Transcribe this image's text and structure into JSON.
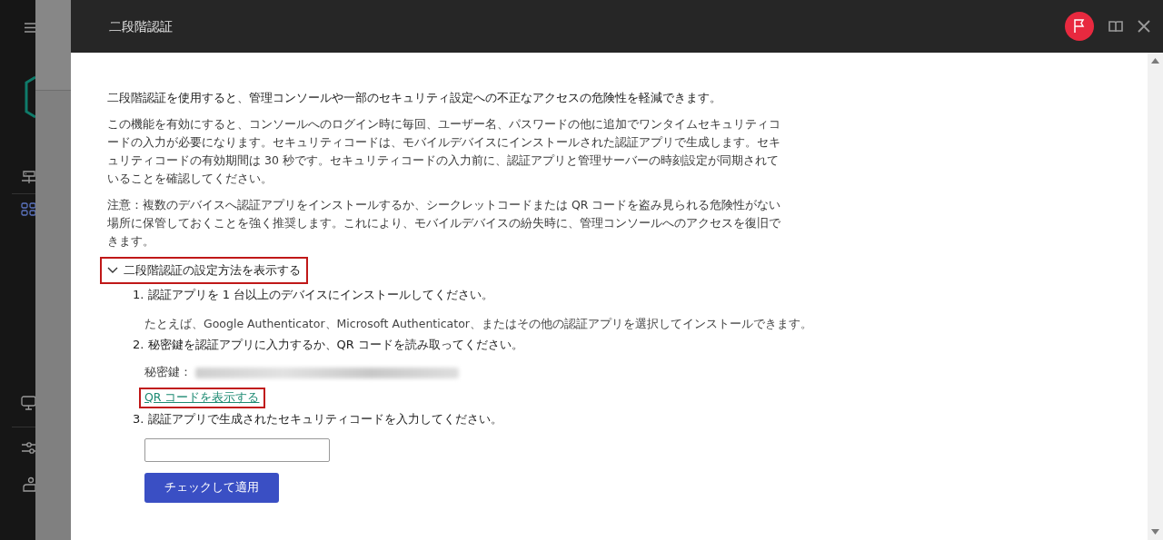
{
  "sidebar": {
    "items": [
      {
        "kind": "network",
        "selected": false
      },
      {
        "kind": "apps",
        "selected": true
      },
      {
        "kind": "monitor",
        "selected": false
      },
      {
        "kind": "sliders",
        "selected": false
      },
      {
        "kind": "user",
        "selected": false
      }
    ]
  },
  "dialog": {
    "title": "二段階認証",
    "intro": "二段階認証を使用すると、管理コンソールや一部のセキュリティ設定への不正なアクセスの危険性を軽減できます。",
    "paragraphs": [
      "この機能を有効にすると、コンソールへのログイン時に毎回、ユーザー名、パスワードの他に追加でワンタイムセキュリティコードの入力が必要になります。セキュリティコードは、モバイルデバイスにインストールされた認証アプリで生成します。セキュリティコードの有効期間は 30 秒です。セキュリティコードの入力前に、認証アプリと管理サーバーの時刻設定が同期されていることを確認してください。",
      "注意：複数のデバイスへ認証アプリをインストールするか、シークレットコードまたは QR コードを盗み見られる危険性がない場所に保管しておくことを強く推奨します。これにより、モバイルデバイスの紛失時に、管理コンソールへのアクセスを復旧できます。"
    ],
    "expander": {
      "label": "二段階認証の設定方法を表示する",
      "expanded": true,
      "highlighted": true
    },
    "steps": [
      {
        "number": "1.",
        "text": "認証アプリを 1 台以上のデバイスにインストールしてください。",
        "note": "たとえば、Google Authenticator、Microsoft Authenticator、またはその他の認証アプリを選択してインストールできます。"
      },
      {
        "number": "2.",
        "text": "秘密鍵を認証アプリに入力するか、QR コードを読み取ってください。",
        "secret_label": "秘密鍵：",
        "link": {
          "label": "QR コードを表示する",
          "highlighted": true
        }
      },
      {
        "number": "3.",
        "text": "認証アプリで生成されたセキュリティコードを入力してください。",
        "has_input": true
      }
    ],
    "apply_button": "チェックして適用"
  }
}
